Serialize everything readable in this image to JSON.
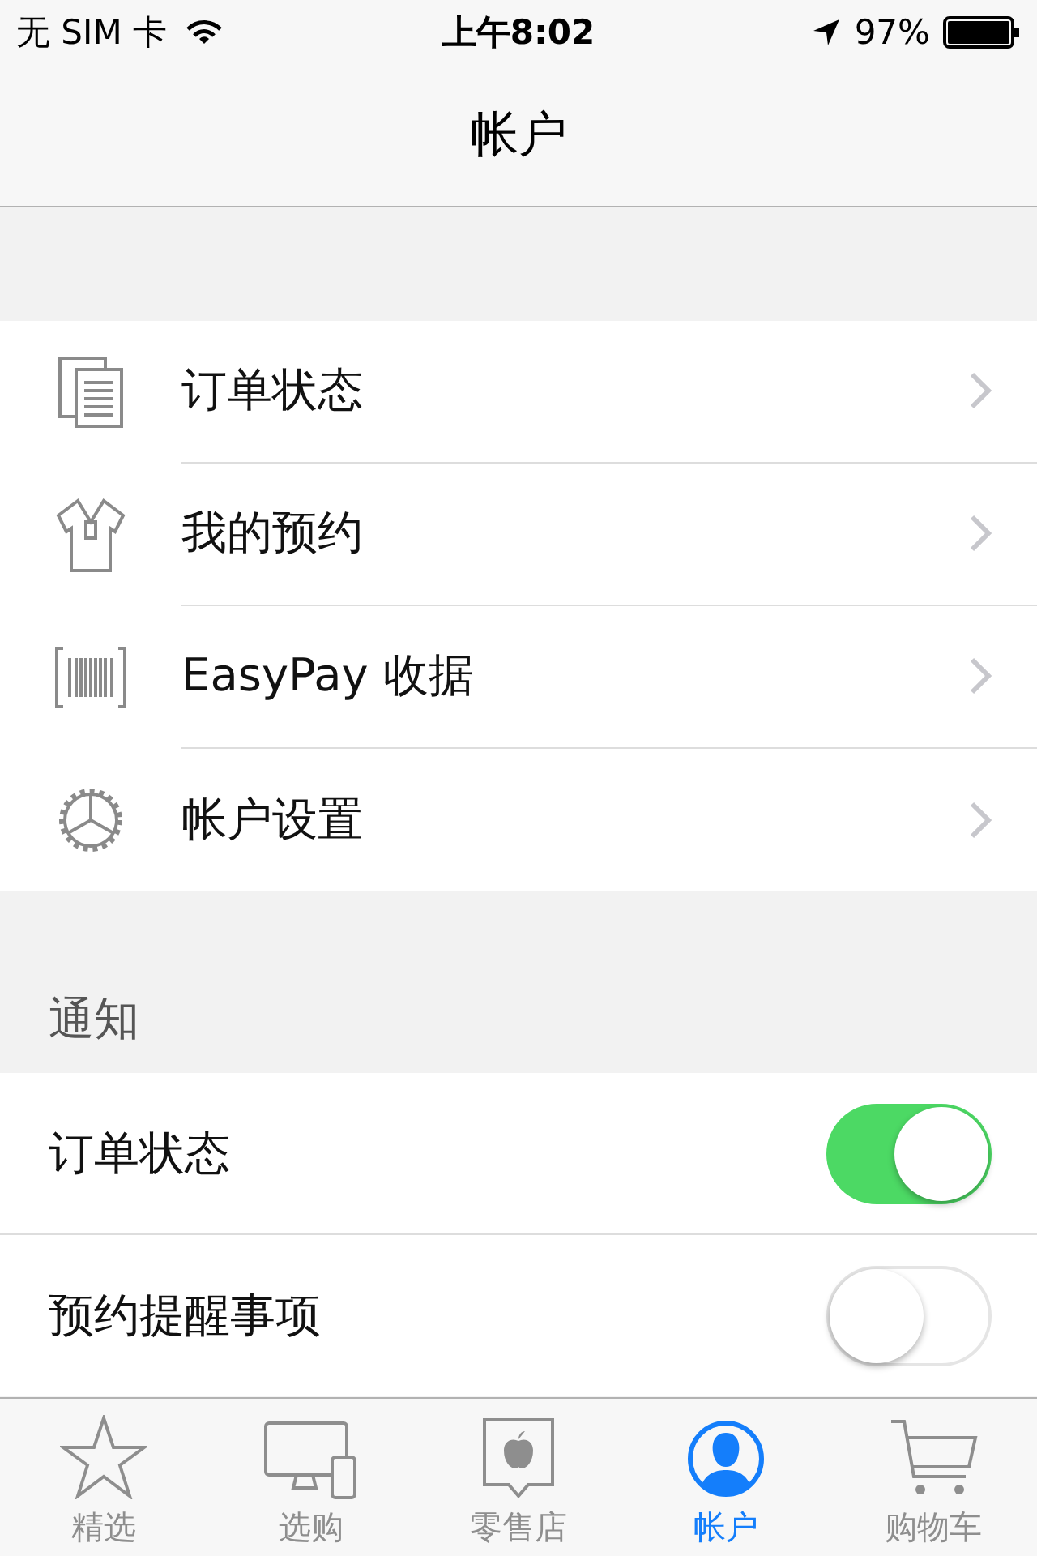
{
  "status_bar": {
    "carrier": "无 SIM 卡",
    "time": "上午8:02",
    "battery": "97%"
  },
  "nav": {
    "title": "帐户"
  },
  "menu": [
    {
      "kind": "documents",
      "label": "订单状态"
    },
    {
      "kind": "shirt",
      "label": "我的预约"
    },
    {
      "kind": "barcode",
      "label": "EasyPay 收据"
    },
    {
      "kind": "gear",
      "label": "帐户设置"
    }
  ],
  "notifications": {
    "header": "通知",
    "items": [
      {
        "label": "订单状态",
        "on": true
      },
      {
        "label": "预约提醒事项",
        "on": false
      }
    ]
  },
  "tab_bar": [
    {
      "kind": "star",
      "label": "精选",
      "selected": false
    },
    {
      "kind": "display",
      "label": "选购",
      "selected": false
    },
    {
      "kind": "store",
      "label": "零售店",
      "selected": false
    },
    {
      "kind": "person",
      "label": "帐户",
      "selected": true
    },
    {
      "kind": "cart",
      "label": "购物车",
      "selected": false
    }
  ]
}
